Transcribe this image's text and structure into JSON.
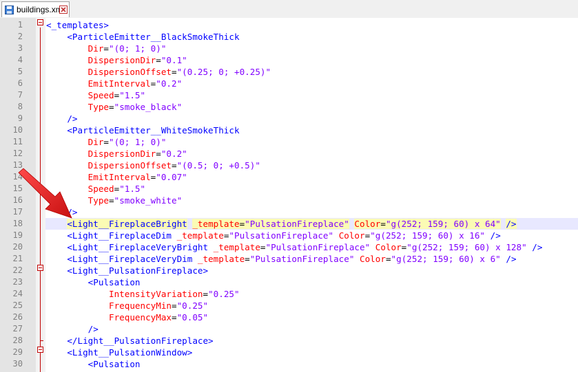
{
  "tab": {
    "title": "buildings.xml",
    "icon": "save-file-icon",
    "close_icon": "close-icon"
  },
  "editor": {
    "active_line": 18,
    "lines": [
      {
        "n": "1",
        "indent": "",
        "parts": [
          {
            "c": "t-tag",
            "t": "<_templates>"
          }
        ]
      },
      {
        "n": "2",
        "indent": "    ",
        "parts": [
          {
            "c": "t-tag",
            "t": "<ParticleEmitter__BlackSmokeThick"
          }
        ]
      },
      {
        "n": "3",
        "indent": "        ",
        "parts": [
          {
            "c": "t-attr",
            "t": "Dir"
          },
          {
            "c": "t-eq",
            "t": "="
          },
          {
            "c": "t-val",
            "t": "\"(0; 1; 0)\""
          }
        ]
      },
      {
        "n": "4",
        "indent": "        ",
        "parts": [
          {
            "c": "t-attr",
            "t": "DispersionDir"
          },
          {
            "c": "t-eq",
            "t": "="
          },
          {
            "c": "t-val",
            "t": "\"0.1\""
          }
        ]
      },
      {
        "n": "5",
        "indent": "        ",
        "parts": [
          {
            "c": "t-attr",
            "t": "DispersionOffset"
          },
          {
            "c": "t-eq",
            "t": "="
          },
          {
            "c": "t-val",
            "t": "\"(0.25; 0; +0.25)\""
          }
        ]
      },
      {
        "n": "6",
        "indent": "        ",
        "parts": [
          {
            "c": "t-attr",
            "t": "EmitInterval"
          },
          {
            "c": "t-eq",
            "t": "="
          },
          {
            "c": "t-val",
            "t": "\"0.2\""
          }
        ]
      },
      {
        "n": "7",
        "indent": "        ",
        "parts": [
          {
            "c": "t-attr",
            "t": "Speed"
          },
          {
            "c": "t-eq",
            "t": "="
          },
          {
            "c": "t-val",
            "t": "\"1.5\""
          }
        ]
      },
      {
        "n": "8",
        "indent": "        ",
        "parts": [
          {
            "c": "t-attr",
            "t": "Type"
          },
          {
            "c": "t-eq",
            "t": "="
          },
          {
            "c": "t-val",
            "t": "\"smoke_black\""
          }
        ]
      },
      {
        "n": "9",
        "indent": "    ",
        "parts": [
          {
            "c": "t-tag",
            "t": "/>"
          }
        ]
      },
      {
        "n": "10",
        "indent": "    ",
        "parts": [
          {
            "c": "t-tag",
            "t": "<ParticleEmitter__WhiteSmokeThick"
          }
        ]
      },
      {
        "n": "11",
        "indent": "        ",
        "parts": [
          {
            "c": "t-attr",
            "t": "Dir"
          },
          {
            "c": "t-eq",
            "t": "="
          },
          {
            "c": "t-val",
            "t": "\"(0; 1; 0)\""
          }
        ]
      },
      {
        "n": "12",
        "indent": "        ",
        "parts": [
          {
            "c": "t-attr",
            "t": "DispersionDir"
          },
          {
            "c": "t-eq",
            "t": "="
          },
          {
            "c": "t-val",
            "t": "\"0.2\""
          }
        ]
      },
      {
        "n": "13",
        "indent": "        ",
        "parts": [
          {
            "c": "t-attr",
            "t": "DispersionOffset"
          },
          {
            "c": "t-eq",
            "t": "="
          },
          {
            "c": "t-val",
            "t": "\"(0.5; 0; +0.5)\""
          }
        ]
      },
      {
        "n": "14",
        "indent": "        ",
        "parts": [
          {
            "c": "t-attr",
            "t": "EmitInterval"
          },
          {
            "c": "t-eq",
            "t": "="
          },
          {
            "c": "t-val",
            "t": "\"0.07\""
          }
        ]
      },
      {
        "n": "15",
        "indent": "        ",
        "parts": [
          {
            "c": "t-attr",
            "t": "Speed"
          },
          {
            "c": "t-eq",
            "t": "="
          },
          {
            "c": "t-val",
            "t": "\"1.5\""
          }
        ]
      },
      {
        "n": "16",
        "indent": "        ",
        "parts": [
          {
            "c": "t-attr",
            "t": "Type"
          },
          {
            "c": "t-eq",
            "t": "="
          },
          {
            "c": "t-val",
            "t": "\"smoke_white\""
          }
        ]
      },
      {
        "n": "17",
        "indent": "    ",
        "parts": [
          {
            "c": "t-tag",
            "t": "/>"
          }
        ]
      },
      {
        "n": "18",
        "indent": "    ",
        "parts": [
          {
            "c": "t-tag t-hi",
            "t": "<Light__FireplaceBright"
          },
          {
            "c": "t-eq",
            "t": " "
          },
          {
            "c": "t-attr t-hi",
            "t": "_template"
          },
          {
            "c": "t-eq t-hi",
            "t": "="
          },
          {
            "c": "t-val t-hi",
            "t": "\"PulsationFireplace\""
          },
          {
            "c": "t-eq",
            "t": " "
          },
          {
            "c": "t-attr t-hi",
            "t": "Color"
          },
          {
            "c": "t-eq t-hi",
            "t": "="
          },
          {
            "c": "t-val t-hi",
            "t": "\"g(252; 159; 60) x 64\""
          },
          {
            "c": "t-eq",
            "t": " "
          },
          {
            "c": "t-tag t-hi",
            "t": "/>"
          }
        ]
      },
      {
        "n": "19",
        "indent": "    ",
        "parts": [
          {
            "c": "t-tag",
            "t": "<Light__FireplaceDim"
          },
          {
            "c": "t-eq",
            "t": " "
          },
          {
            "c": "t-attr",
            "t": "_template"
          },
          {
            "c": "t-eq",
            "t": "="
          },
          {
            "c": "t-val",
            "t": "\"PulsationFireplace\""
          },
          {
            "c": "t-eq",
            "t": " "
          },
          {
            "c": "t-attr",
            "t": "Color"
          },
          {
            "c": "t-eq",
            "t": "="
          },
          {
            "c": "t-val",
            "t": "\"g(252; 159; 60) x 16\""
          },
          {
            "c": "t-eq",
            "t": " "
          },
          {
            "c": "t-tag",
            "t": "/>"
          }
        ]
      },
      {
        "n": "20",
        "indent": "    ",
        "parts": [
          {
            "c": "t-tag",
            "t": "<Light__FireplaceVeryBright"
          },
          {
            "c": "t-eq",
            "t": " "
          },
          {
            "c": "t-attr",
            "t": "_template"
          },
          {
            "c": "t-eq",
            "t": "="
          },
          {
            "c": "t-val",
            "t": "\"PulsationFireplace\""
          },
          {
            "c": "t-eq",
            "t": " "
          },
          {
            "c": "t-attr",
            "t": "Color"
          },
          {
            "c": "t-eq",
            "t": "="
          },
          {
            "c": "t-val",
            "t": "\"g(252; 159; 60) x 128\""
          },
          {
            "c": "t-eq",
            "t": " "
          },
          {
            "c": "t-tag",
            "t": "/>"
          }
        ]
      },
      {
        "n": "21",
        "indent": "    ",
        "parts": [
          {
            "c": "t-tag",
            "t": "<Light__FireplaceVeryDim"
          },
          {
            "c": "t-eq",
            "t": " "
          },
          {
            "c": "t-attr",
            "t": "_template"
          },
          {
            "c": "t-eq",
            "t": "="
          },
          {
            "c": "t-val",
            "t": "\"PulsationFireplace\""
          },
          {
            "c": "t-eq",
            "t": " "
          },
          {
            "c": "t-attr",
            "t": "Color"
          },
          {
            "c": "t-eq",
            "t": "="
          },
          {
            "c": "t-val",
            "t": "\"g(252; 159; 60) x 6\""
          },
          {
            "c": "t-eq",
            "t": " "
          },
          {
            "c": "t-tag",
            "t": "/>"
          }
        ]
      },
      {
        "n": "22",
        "indent": "    ",
        "parts": [
          {
            "c": "t-tag",
            "t": "<Light__PulsationFireplace>"
          }
        ]
      },
      {
        "n": "23",
        "indent": "        ",
        "parts": [
          {
            "c": "t-tag",
            "t": "<Pulsation"
          }
        ]
      },
      {
        "n": "24",
        "indent": "            ",
        "parts": [
          {
            "c": "t-attr",
            "t": "IntensityVariation"
          },
          {
            "c": "t-eq",
            "t": "="
          },
          {
            "c": "t-val",
            "t": "\"0.25\""
          }
        ]
      },
      {
        "n": "25",
        "indent": "            ",
        "parts": [
          {
            "c": "t-attr",
            "t": "FrequencyMin"
          },
          {
            "c": "t-eq",
            "t": "="
          },
          {
            "c": "t-val",
            "t": "\"0.25\""
          }
        ]
      },
      {
        "n": "26",
        "indent": "            ",
        "parts": [
          {
            "c": "t-attr",
            "t": "FrequencyMax"
          },
          {
            "c": "t-eq",
            "t": "="
          },
          {
            "c": "t-val",
            "t": "\"0.05\""
          }
        ]
      },
      {
        "n": "27",
        "indent": "        ",
        "parts": [
          {
            "c": "t-tag",
            "t": "/>"
          }
        ]
      },
      {
        "n": "28",
        "indent": "    ",
        "parts": [
          {
            "c": "t-tag",
            "t": "</Light__PulsationFireplace>"
          }
        ]
      },
      {
        "n": "29",
        "indent": "    ",
        "parts": [
          {
            "c": "t-tag",
            "t": "<Light__PulsationWindow>"
          }
        ]
      },
      {
        "n": "30",
        "indent": "        ",
        "parts": [
          {
            "c": "t-tag",
            "t": "<Pulsation"
          }
        ]
      }
    ]
  },
  "annotation": {
    "icon": "red-arrow-icon",
    "color": "#e41e1e",
    "points_to_line": 18
  }
}
